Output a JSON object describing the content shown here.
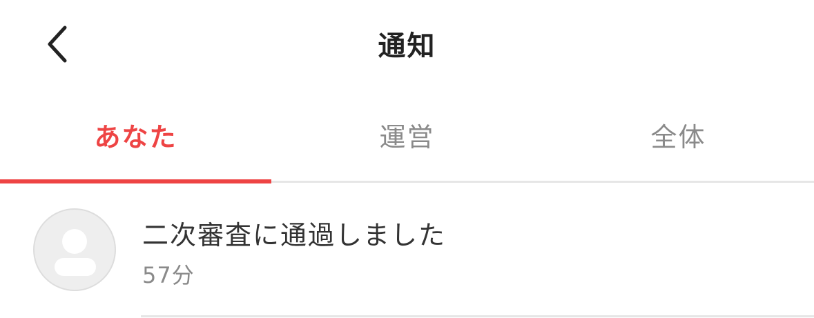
{
  "header": {
    "title": "通知",
    "back_icon": "chevron-left-icon"
  },
  "tabs": [
    {
      "label": "あなた",
      "active": true
    },
    {
      "label": "運営",
      "active": false
    },
    {
      "label": "全体",
      "active": false
    }
  ],
  "colors": {
    "accent": "#ee4444",
    "inactive_text": "#8a8a8a",
    "title_text": "#222222",
    "divider": "#e6e6e6"
  },
  "notifications": [
    {
      "title": "二次審査に通過しました",
      "time": "57分",
      "avatar_icon": "user-placeholder-icon"
    }
  ]
}
